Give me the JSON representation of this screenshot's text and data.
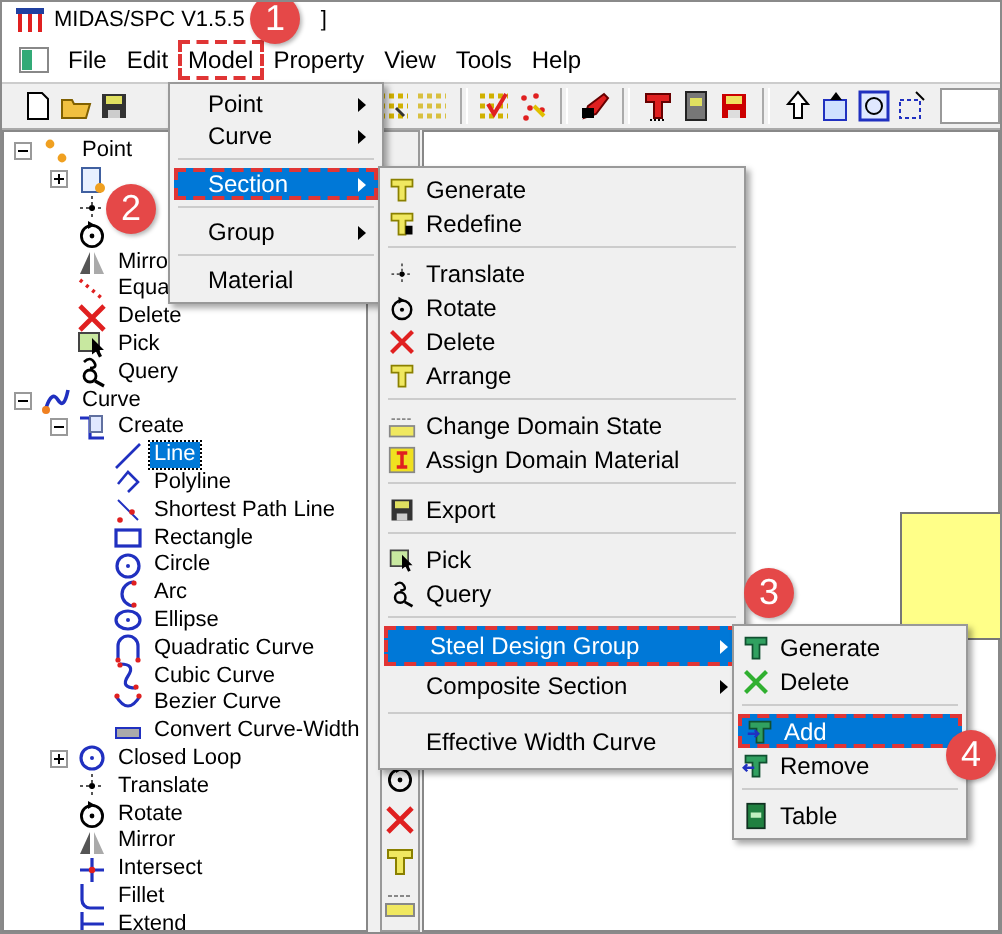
{
  "window": {
    "title": "MIDAS/SPC V1.5.5",
    "title_tail": "]"
  },
  "menu_bar": [
    {
      "label": "File",
      "outlined": false
    },
    {
      "label": "Edit",
      "outlined": false
    },
    {
      "label": "Model",
      "outlined": true
    },
    {
      "label": "Property",
      "outlined": false
    },
    {
      "label": "View",
      "outlined": false
    },
    {
      "label": "Tools",
      "outlined": false
    },
    {
      "label": "Help",
      "outlined": false
    }
  ],
  "tree": [
    {
      "label": "Point",
      "selected": false,
      "expanded": true,
      "children": [
        {
          "selected": false,
          "expanded": false
        },
        {
          "selected": false
        },
        {
          "selected": false
        },
        {
          "label": "Mirro",
          "selected": false
        },
        {
          "label": "Equa",
          "selected": false
        },
        {
          "label": "Delete",
          "selected": false
        },
        {
          "label": "Pick",
          "selected": false
        },
        {
          "label": "Query",
          "selected": false
        }
      ]
    },
    {
      "label": "Curve",
      "selected": false,
      "expanded": true,
      "children": [
        {
          "label": "Create",
          "selected": false,
          "expanded": true,
          "children": [
            {
              "label": "Line",
              "selected": true
            },
            {
              "label": "Polyline",
              "selected": false
            },
            {
              "label": "Shortest Path Line",
              "selected": false
            },
            {
              "label": "Rectangle",
              "selected": false
            },
            {
              "label": "Circle",
              "selected": false
            },
            {
              "label": "Arc",
              "selected": false
            },
            {
              "label": "Ellipse",
              "selected": false
            },
            {
              "label": "Quadratic Curve",
              "selected": false
            },
            {
              "label": "Cubic Curve",
              "selected": false
            },
            {
              "label": "Bezier Curve",
              "selected": false
            },
            {
              "label": "Convert Curve-Width",
              "selected": false
            }
          ]
        },
        {
          "label": "Closed Loop",
          "selected": false,
          "expanded": false
        },
        {
          "label": "Translate",
          "selected": false
        },
        {
          "label": "Rotate",
          "selected": false
        },
        {
          "label": "Mirror",
          "selected": false
        },
        {
          "label": "Intersect",
          "selected": false
        },
        {
          "label": "Fillet",
          "selected": false
        },
        {
          "label": "Extend",
          "selected": false
        }
      ]
    }
  ],
  "model_menu": {
    "items": [
      {
        "kind": "item",
        "label": "Point",
        "has_submenu": true,
        "selected": false,
        "outlined": false
      },
      {
        "kind": "item",
        "label": "Curve",
        "has_submenu": true,
        "selected": false,
        "outlined": false
      },
      {
        "kind": "separator"
      },
      {
        "kind": "item",
        "label": "Section",
        "has_submenu": true,
        "selected": true,
        "outlined": true
      },
      {
        "kind": "separator"
      },
      {
        "kind": "item",
        "label": "Group",
        "has_submenu": true,
        "selected": false,
        "outlined": false
      },
      {
        "kind": "separator"
      },
      {
        "kind": "item",
        "label": "Material",
        "has_submenu": false,
        "selected": false,
        "outlined": false
      }
    ]
  },
  "section_menu": {
    "items": [
      {
        "kind": "item",
        "label": "Generate",
        "has_submenu": false,
        "selected": false,
        "outlined": false
      },
      {
        "kind": "item",
        "label": "Redefine",
        "has_submenu": false,
        "selected": false,
        "outlined": false
      },
      {
        "kind": "separator"
      },
      {
        "kind": "item",
        "label": "Translate",
        "has_submenu": false,
        "selected": false,
        "outlined": false
      },
      {
        "kind": "item",
        "label": "Rotate",
        "has_submenu": false,
        "selected": false,
        "outlined": false
      },
      {
        "kind": "item",
        "label": "Delete",
        "has_submenu": false,
        "selected": false,
        "outlined": false
      },
      {
        "kind": "item",
        "label": "Arrange",
        "has_submenu": false,
        "selected": false,
        "outlined": false
      },
      {
        "kind": "separator"
      },
      {
        "kind": "item",
        "label": "Change Domain State",
        "has_submenu": false,
        "selected": false,
        "outlined": false
      },
      {
        "kind": "item",
        "label": "Assign Domain Material",
        "has_submenu": false,
        "selected": false,
        "outlined": false
      },
      {
        "kind": "separator"
      },
      {
        "kind": "item",
        "label": "Export",
        "has_submenu": false,
        "selected": false,
        "outlined": false
      },
      {
        "kind": "separator"
      },
      {
        "kind": "item",
        "label": "Pick",
        "has_submenu": false,
        "selected": false,
        "outlined": false
      },
      {
        "kind": "item",
        "label": "Query",
        "has_submenu": false,
        "selected": false,
        "outlined": false
      },
      {
        "kind": "separator"
      },
      {
        "kind": "item",
        "label": "Steel Design Group",
        "has_submenu": true,
        "selected": true,
        "outlined": true
      },
      {
        "kind": "item",
        "label": "Composite Section",
        "has_submenu": true,
        "selected": false,
        "outlined": false
      },
      {
        "kind": "separator"
      },
      {
        "kind": "item",
        "label": "Effective Width Curve",
        "has_submenu": false,
        "selected": false,
        "outlined": false
      }
    ]
  },
  "steel_design_group_menu": {
    "items": [
      {
        "kind": "item",
        "label": "Generate",
        "has_submenu": false,
        "selected": false,
        "outlined": false
      },
      {
        "kind": "item",
        "label": "Delete",
        "has_submenu": false,
        "selected": false,
        "outlined": false
      },
      {
        "kind": "separator"
      },
      {
        "kind": "item",
        "label": "Add",
        "has_submenu": false,
        "selected": true,
        "outlined": true
      },
      {
        "kind": "item",
        "label": "Remove",
        "has_submenu": false,
        "selected": false,
        "outlined": false
      },
      {
        "kind": "separator"
      },
      {
        "kind": "item",
        "label": "Table",
        "has_submenu": false,
        "selected": false,
        "outlined": false
      }
    ]
  },
  "callouts": [
    {
      "number": "1"
    },
    {
      "number": "2"
    },
    {
      "number": "3"
    },
    {
      "number": "4"
    }
  ]
}
